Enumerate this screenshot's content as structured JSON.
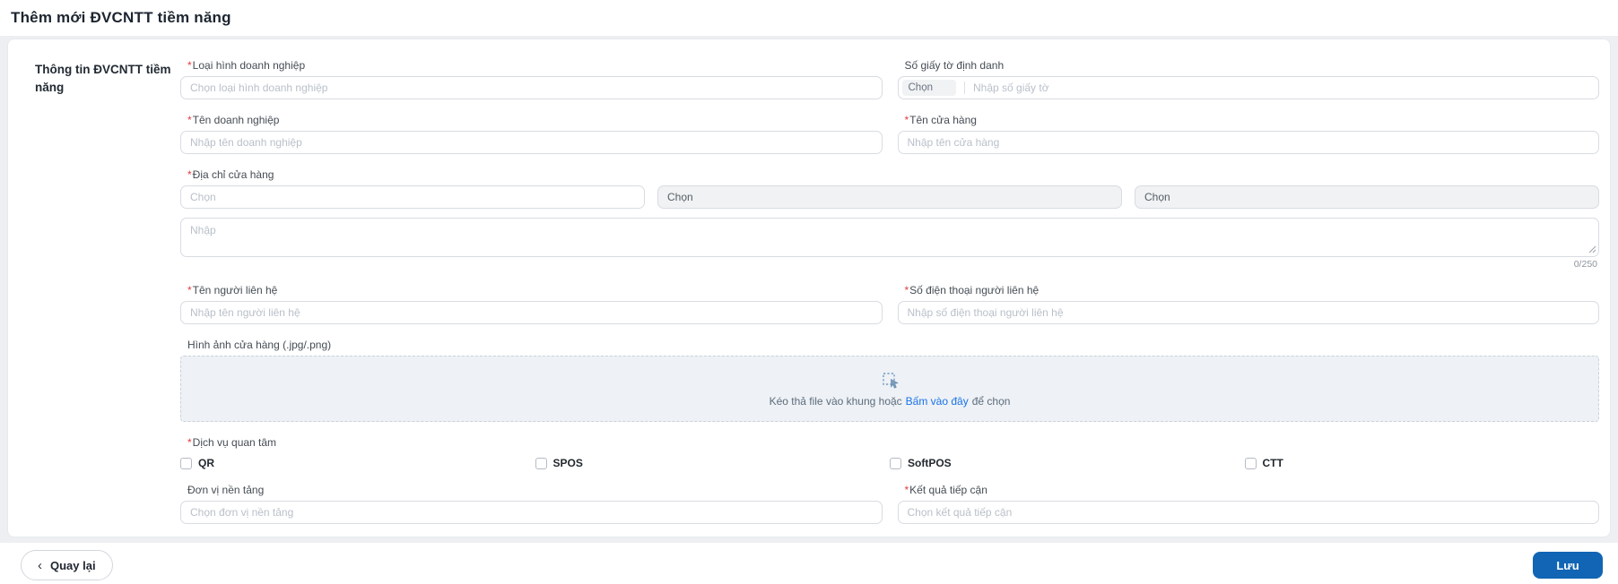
{
  "header": {
    "title": "Thêm mới ĐVCNTT tiềm năng"
  },
  "required_mark": "*",
  "section_title": "Thông tin ĐVCNTT tiềm năng",
  "fields": {
    "business_type": {
      "label": "Loại hình doanh nghiệp",
      "placeholder": "Chọn loại hình doanh nghiệp"
    },
    "identity_doc": {
      "label": "Số giấy tờ định danh",
      "type_placeholder": "Chọn",
      "number_placeholder": "Nhập số giấy tờ"
    },
    "business_name": {
      "label": "Tên doanh nghiệp",
      "placeholder": "Nhập tên doanh nghiệp"
    },
    "store_name": {
      "label": "Tên cửa hàng",
      "placeholder": "Nhập tên cửa hàng"
    },
    "store_address": {
      "label": "Địa chỉ cửa hàng",
      "province_placeholder": "Chọn",
      "district_placeholder": "Chọn",
      "ward_placeholder": "Chọn",
      "detail_placeholder": "Nhập",
      "char_counter": "0/250"
    },
    "contact_name": {
      "label": "Tên người liên hệ",
      "placeholder": "Nhập tên người liên hệ"
    },
    "contact_phone": {
      "label": "Số điện thoại người liên hệ",
      "placeholder": "Nhập số điện thoại người liên hệ"
    },
    "store_image": {
      "label": "Hình ảnh cửa hàng (.jpg/.png)",
      "dropzone_text_before": "Kéo thả file vào khung hoặc",
      "dropzone_link": "Bấm vào đây",
      "dropzone_text_after": "để chọn"
    },
    "services": {
      "label": "Dịch vụ quan tâm",
      "options": [
        {
          "label": "QR"
        },
        {
          "label": "SPOS"
        },
        {
          "label": "SoftPOS"
        },
        {
          "label": "CTT"
        }
      ]
    },
    "platform_unit": {
      "label": "Đơn vị nền tảng",
      "placeholder": "Chọn đơn vị nền tảng"
    },
    "approach_result": {
      "label": "Kết quả tiếp cận",
      "placeholder": "Chọn kết quả tiếp cận"
    }
  },
  "footer": {
    "back_icon": "‹",
    "back_label": "Quay lại",
    "save_label": "Lưu"
  },
  "colors": {
    "primary": "#1165b4",
    "required": "#e23b3f",
    "link": "#1a73e8"
  }
}
